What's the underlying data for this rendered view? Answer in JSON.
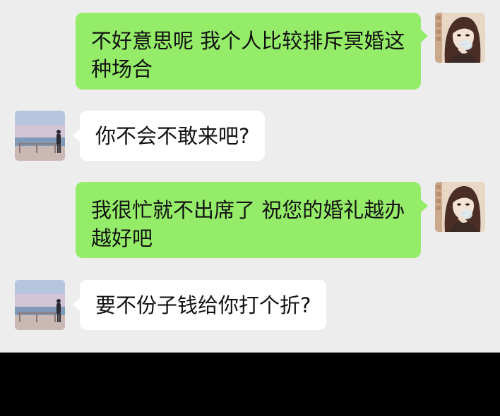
{
  "messages": [
    {
      "sender": "self",
      "text": "不好意思呢 我个人比较排斥冥婚这种场合"
    },
    {
      "sender": "other",
      "text": "你不会不敢来吧?"
    },
    {
      "sender": "self",
      "text": "我很忙就不出席了 祝您的婚礼越办越好吧"
    },
    {
      "sender": "other",
      "text": "要不份子钱给你打个折?"
    }
  ],
  "colors": {
    "chat_background": "#ededed",
    "sent_bubble": "#95ec69",
    "received_bubble": "#ffffff",
    "text": "#111111",
    "bottom_band": "#000000"
  },
  "icons": {
    "self_avatar": "illustrated-girl-avatar",
    "other_avatar": "seaside-silhouette-avatar"
  }
}
